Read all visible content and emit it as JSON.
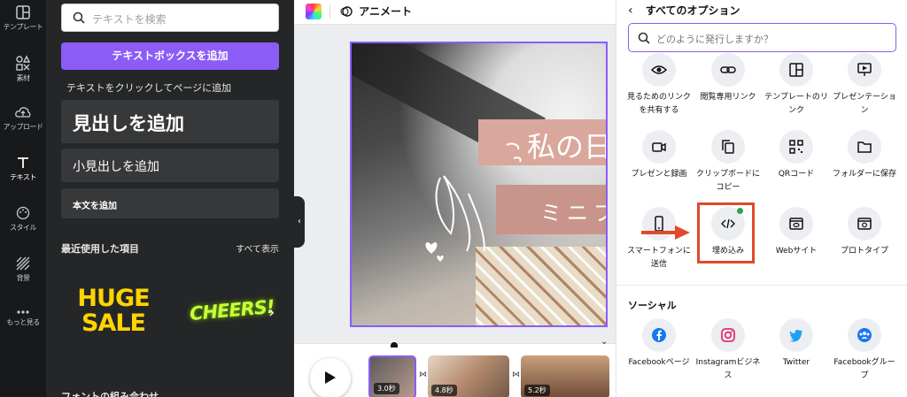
{
  "rail": {
    "items": [
      {
        "label": "テンプレート",
        "icon": "template-icon"
      },
      {
        "label": "素材",
        "icon": "elements-icon"
      },
      {
        "label": "アップロード",
        "icon": "upload-icon"
      },
      {
        "label": "テキスト",
        "icon": "text-icon"
      },
      {
        "label": "スタイル",
        "icon": "palette-icon"
      },
      {
        "label": "背景",
        "icon": "background-icon"
      },
      {
        "label": "もっと見る",
        "icon": "more-icon"
      }
    ],
    "active": "テキスト"
  },
  "text_panel": {
    "search_placeholder": "テキストを検索",
    "add_textbox": "テキストボックスを追加",
    "hint": "テキストをクリックしてページに追加",
    "heading": "見出しを追加",
    "subheading": "小見出しを追加",
    "body": "本文を追加",
    "recent_title": "最近使用した項目",
    "see_all": "すべて表示",
    "recent_items": [
      "HUGE",
      "SALE",
      "CHEERS!"
    ],
    "font_combos": "フォントの組み合わせ"
  },
  "editor": {
    "animate_label": "アニメート",
    "canvas_text_1": "私の日",
    "canvas_text_2": "ミニブ",
    "timeline": [
      {
        "duration": "3.0秒"
      },
      {
        "duration": "4.8秒"
      },
      {
        "duration": "5.2秒"
      }
    ]
  },
  "share_panel": {
    "title": "すべてのオプション",
    "search_placeholder": "どのように発行しますか？",
    "options": [
      {
        "label": "見るためのリンクを共有する",
        "icon": "eye-icon"
      },
      {
        "label": "閲覧専用リンク",
        "icon": "link-icon"
      },
      {
        "label": "テンプレートのリンク",
        "icon": "template-link-icon"
      },
      {
        "label": "プレゼンテーション",
        "icon": "present-icon"
      },
      {
        "label": "プレゼンと録画",
        "icon": "camera-icon"
      },
      {
        "label": "クリップボードにコピー",
        "icon": "copy-icon"
      },
      {
        "label": "QRコード",
        "icon": "qr-icon"
      },
      {
        "label": "フォルダーに保存",
        "icon": "folder-icon"
      },
      {
        "label": "スマートフォンに送信",
        "icon": "phone-icon"
      },
      {
        "label": "埋め込み",
        "icon": "embed-icon"
      },
      {
        "label": "Webサイト",
        "icon": "website-icon"
      },
      {
        "label": "プロトタイプ",
        "icon": "prototype-icon"
      }
    ],
    "social_title": "ソーシャル",
    "social": [
      {
        "label": "Facebookページ",
        "icon": "facebook-icon",
        "color": "#1877f2"
      },
      {
        "label": "Instagramビジネス",
        "icon": "instagram-icon",
        "color": "#e1306c"
      },
      {
        "label": "Twitter",
        "icon": "twitter-icon",
        "color": "#1da1f2"
      },
      {
        "label": "Facebookグループ",
        "icon": "facebook-group-icon",
        "color": "#1877f2"
      }
    ]
  },
  "colors": {
    "accent": "#8b5cf6",
    "highlight": "#e04a2a",
    "rail_bg": "#18191b",
    "panel_bg": "#252627"
  }
}
